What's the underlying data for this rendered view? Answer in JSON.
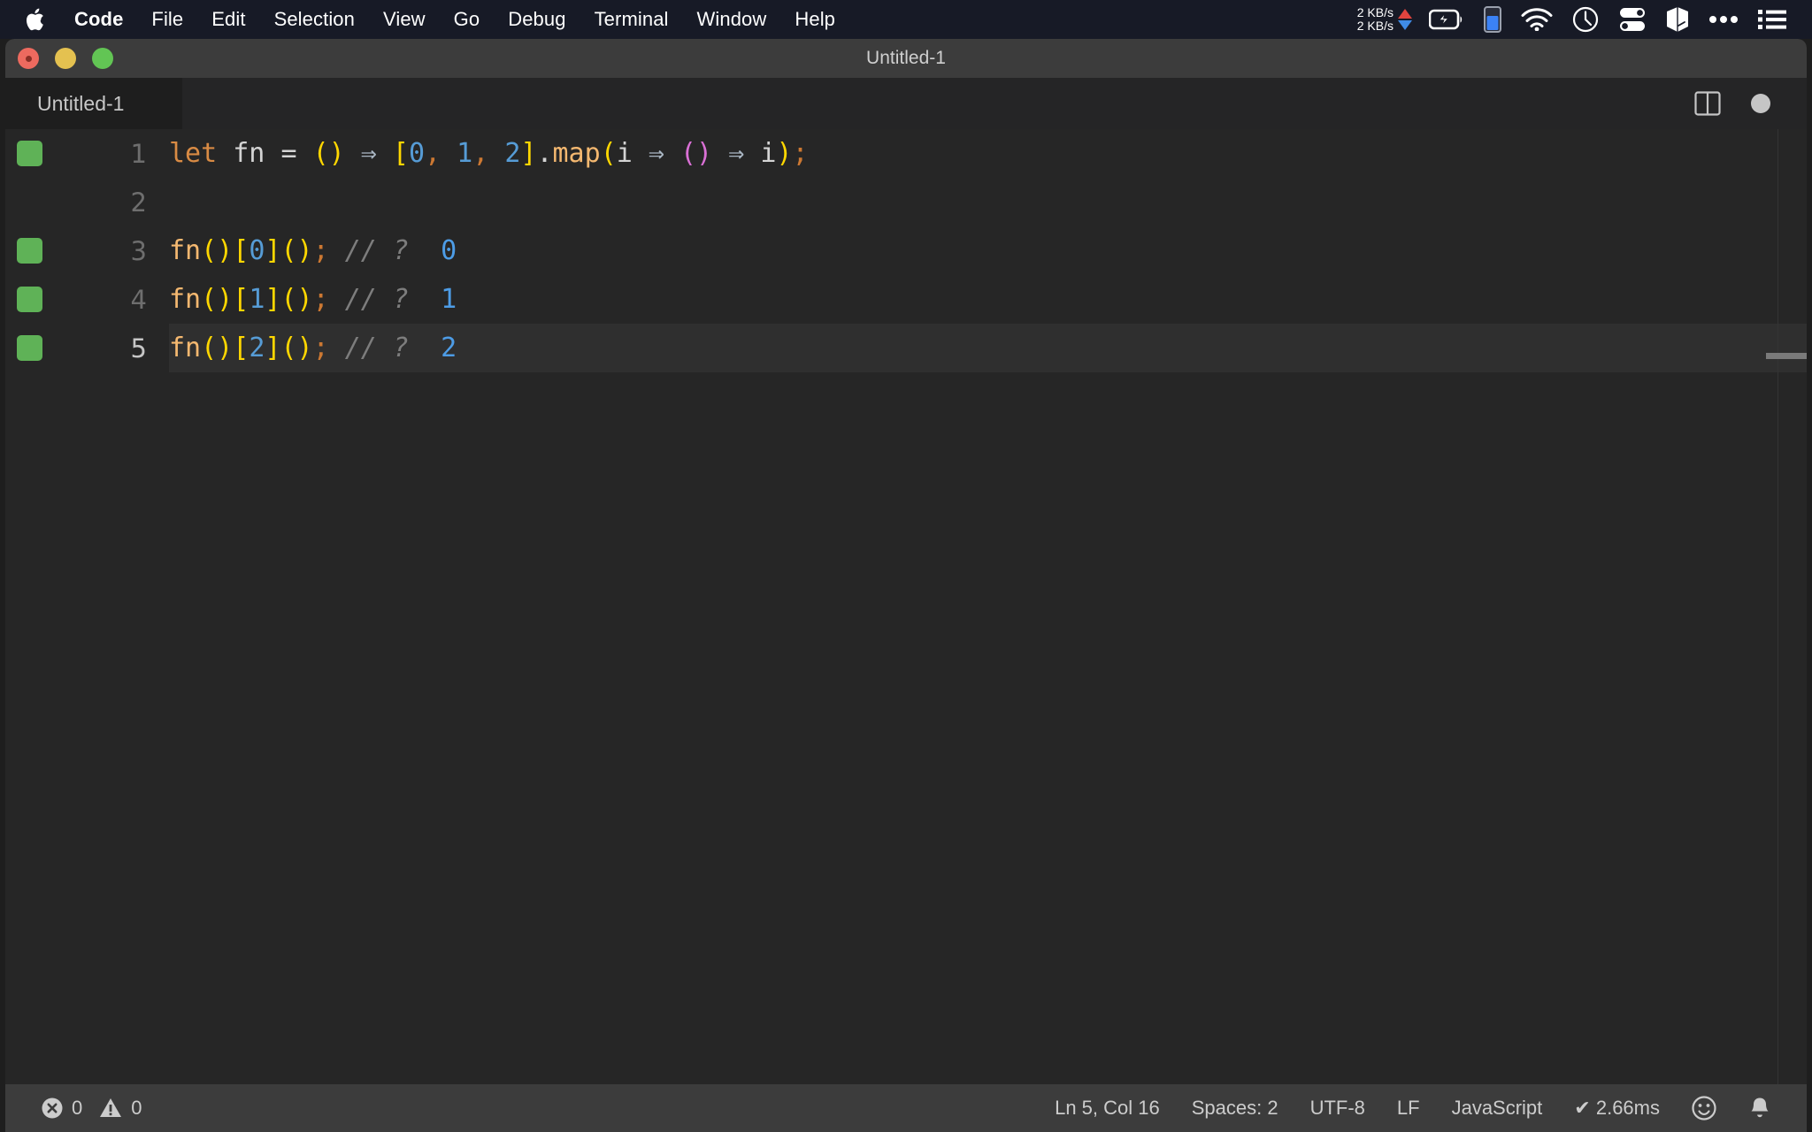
{
  "menubar": {
    "apple_icon": "apple-logo-icon",
    "items": [
      {
        "label": "Code",
        "bold": true
      },
      {
        "label": "File",
        "bold": false
      },
      {
        "label": "Edit",
        "bold": false
      },
      {
        "label": "Selection",
        "bold": false
      },
      {
        "label": "View",
        "bold": false
      },
      {
        "label": "Go",
        "bold": false
      },
      {
        "label": "Debug",
        "bold": false
      },
      {
        "label": "Terminal",
        "bold": false
      },
      {
        "label": "Window",
        "bold": false
      },
      {
        "label": "Help",
        "bold": false
      }
    ],
    "tray": {
      "net_up": "2 KB/s",
      "net_down": "2 KB/s",
      "icons": [
        "battery-charging-icon",
        "battery-level-icon",
        "wifi-icon",
        "clock-icon",
        "control-center-icon",
        "cube-icon",
        "ellipsis-icon",
        "list-menu-icon"
      ]
    },
    "colors": {
      "bar_bg": "#171a26",
      "arrow_up": "#e0443e",
      "arrow_down": "#3f8ce8",
      "battery_fill": "#3b82f6"
    }
  },
  "window": {
    "title": "Untitled-1",
    "traffic_lights": [
      "close-button",
      "minimize-button",
      "zoom-button"
    ],
    "colors": {
      "close": "#ed6a5f",
      "minimize": "#e4c150",
      "zoom": "#62c554"
    }
  },
  "tabbar": {
    "active_tab": "Untitled-1",
    "split_editor_icon": "split-editor-icon",
    "dirty_indicator": "unsaved-dot-icon"
  },
  "editor": {
    "language": "JavaScript",
    "background": "#262626",
    "active_line": 5,
    "lines": [
      {
        "number": "1",
        "marker": true,
        "active": false,
        "tokens": [
          {
            "text": "let",
            "cls": "t-kw"
          },
          {
            "text": " ",
            "cls": "t-var"
          },
          {
            "text": "fn",
            "cls": "t-var"
          },
          {
            "text": " ",
            "cls": "t-var"
          },
          {
            "text": "=",
            "cls": "t-op"
          },
          {
            "text": " ",
            "cls": "t-var"
          },
          {
            "text": "()",
            "cls": "t-paren"
          },
          {
            "text": " ",
            "cls": "t-var"
          },
          {
            "text": "⇒",
            "cls": "t-arrow"
          },
          {
            "text": " ",
            "cls": "t-var"
          },
          {
            "text": "[",
            "cls": "t-paren"
          },
          {
            "text": "0",
            "cls": "t-num"
          },
          {
            "text": ",",
            "cls": "t-punc"
          },
          {
            "text": " ",
            "cls": "t-var"
          },
          {
            "text": "1",
            "cls": "t-num"
          },
          {
            "text": ",",
            "cls": "t-punc"
          },
          {
            "text": " ",
            "cls": "t-var"
          },
          {
            "text": "2",
            "cls": "t-num"
          },
          {
            "text": "]",
            "cls": "t-paren"
          },
          {
            "text": ".",
            "cls": "t-var"
          },
          {
            "text": "map",
            "cls": "t-fn"
          },
          {
            "text": "(",
            "cls": "t-paren"
          },
          {
            "text": "i",
            "cls": "t-var"
          },
          {
            "text": " ",
            "cls": "t-var"
          },
          {
            "text": "⇒",
            "cls": "t-arrow"
          },
          {
            "text": " ",
            "cls": "t-var"
          },
          {
            "text": "()",
            "cls": "t-paren2"
          },
          {
            "text": " ",
            "cls": "t-var"
          },
          {
            "text": "⇒",
            "cls": "t-arrow"
          },
          {
            "text": " ",
            "cls": "t-var"
          },
          {
            "text": "i",
            "cls": "t-var"
          },
          {
            "text": ")",
            "cls": "t-paren"
          },
          {
            "text": ";",
            "cls": "t-punc"
          }
        ]
      },
      {
        "number": "2",
        "marker": false,
        "active": false,
        "tokens": []
      },
      {
        "number": "3",
        "marker": true,
        "active": false,
        "tokens": [
          {
            "text": "fn",
            "cls": "t-fn"
          },
          {
            "text": "()",
            "cls": "t-paren"
          },
          {
            "text": "[",
            "cls": "t-paren"
          },
          {
            "text": "0",
            "cls": "t-num"
          },
          {
            "text": "]",
            "cls": "t-paren"
          },
          {
            "text": "()",
            "cls": "t-paren"
          },
          {
            "text": ";",
            "cls": "t-punc"
          },
          {
            "text": " ",
            "cls": "t-var"
          },
          {
            "text": "// ?",
            "cls": "t-comment"
          },
          {
            "text": "  ",
            "cls": "t-var"
          },
          {
            "text": "0",
            "cls": "t-result"
          }
        ]
      },
      {
        "number": "4",
        "marker": true,
        "active": false,
        "tokens": [
          {
            "text": "fn",
            "cls": "t-fn"
          },
          {
            "text": "()",
            "cls": "t-paren"
          },
          {
            "text": "[",
            "cls": "t-paren"
          },
          {
            "text": "1",
            "cls": "t-num"
          },
          {
            "text": "]",
            "cls": "t-paren"
          },
          {
            "text": "()",
            "cls": "t-paren"
          },
          {
            "text": ";",
            "cls": "t-punc"
          },
          {
            "text": " ",
            "cls": "t-var"
          },
          {
            "text": "// ?",
            "cls": "t-comment"
          },
          {
            "text": "  ",
            "cls": "t-var"
          },
          {
            "text": "1",
            "cls": "t-result"
          }
        ]
      },
      {
        "number": "5",
        "marker": true,
        "active": true,
        "tokens": [
          {
            "text": "fn",
            "cls": "t-fn"
          },
          {
            "text": "()",
            "cls": "t-paren"
          },
          {
            "text": "[",
            "cls": "t-paren"
          },
          {
            "text": "2",
            "cls": "t-num"
          },
          {
            "text": "]",
            "cls": "t-paren"
          },
          {
            "text": "()",
            "cls": "t-paren"
          },
          {
            "text": ";",
            "cls": "t-punc"
          },
          {
            "text": " ",
            "cls": "t-var"
          },
          {
            "text": "// ?",
            "cls": "t-comment"
          },
          {
            "text": "  ",
            "cls": "t-var"
          },
          {
            "text": "2",
            "cls": "t-result"
          }
        ]
      }
    ]
  },
  "statusbar": {
    "errors": "0",
    "warnings": "0",
    "error_icon": "error-circle-icon",
    "warning_icon": "warning-triangle-icon",
    "cursor_position": "Ln 5, Col 16",
    "indentation": "Spaces: 2",
    "encoding": "UTF-8",
    "eol": "LF",
    "language": "JavaScript",
    "run_time": "✔ 2.66ms",
    "feedback_icon": "smiley-icon",
    "notifications_icon": "bell-icon"
  }
}
